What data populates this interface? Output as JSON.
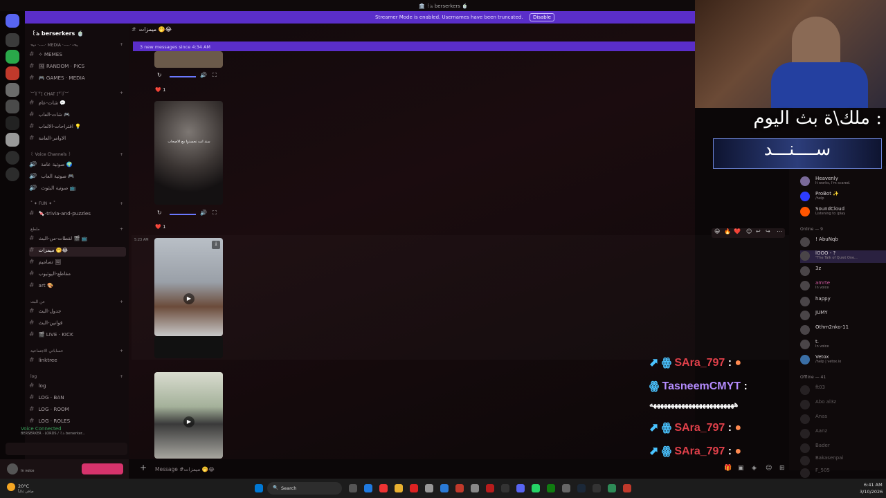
{
  "window": {
    "title": "🏛️ ꒰ঌ berserkers 🍵"
  },
  "banner": {
    "message": "Streamer Mode is enabled. Usernames have been truncated.",
    "disable": "Disable"
  },
  "server": {
    "name": "꒰ঌ berserkers 🍵"
  },
  "channel_header": {
    "name": "ميمزات 🤭😂"
  },
  "new_messages": "3 new messages since 4:34 AM",
  "channels": [
    {
      "label": "✧ MEMES",
      "type": "channel",
      "y": 0
    },
    {
      "label": "🖼 RANDOM · PICS",
      "type": "channel"
    },
    {
      "label": "🎮 GAMES · MEDIA",
      "type": "channel"
    }
  ],
  "categories": {
    "media": "ᯓ˖ ·----· MEDIA ·----· ˖ᯓ",
    "chat": "︶꒦꒷[ CHAT ]꒷꒦︶",
    "voice": "꒰ Voice Channels ꒱",
    "fun": "˚ ✦ FUN ✦ ˚",
    "bonus": "ملطع",
    "about": "عن البث",
    "social": "حساباتي الاجتماعية",
    "log": "log"
  },
  "chat_channels": [
    "شات-عام 💬",
    "شات-العاب 🎮",
    "اقتراحات-الالعاب 💡",
    "الاوامر-العامة"
  ],
  "voice_channels": [
    "صوتية عامة 🌍",
    "صوتية العاب 🎮",
    "صوتية البثوث 📺"
  ],
  "fun_channels": [
    "🍬-trivia-and-puzzles"
  ],
  "bonus_channels": [
    "لقطات-من-البث 🎬 📺",
    "ميمزات 🤭😂",
    "تصاميم 🖼",
    "مقاطع-اليوتيوب",
    "art 🎨"
  ],
  "about_channels": [
    "جدول-البث",
    "قوانين-البث",
    "🎬 LIVE · KICK"
  ],
  "social_channels": [
    "linktree"
  ],
  "log_channels": [
    "log",
    "LOG · BAN",
    "LOG · ROOM",
    "LOG · ROLES"
  ],
  "voice_connected": {
    "title": "Voice Connected",
    "sub": "BERSERKER · LORDS / ꒰ঌ berserker..."
  },
  "user": {
    "status": "In voice"
  },
  "messages": {
    "time": "5:23 AM",
    "reaction_count": "1",
    "video_caption": "سند انت تحسدوا مع الاصحاب"
  },
  "input": {
    "placeholder": "Message #ميمزات 🤭😂"
  },
  "members": {
    "bots": [
      {
        "name": "Heavenly",
        "badge": "APP",
        "status": "It works, I'm scared."
      },
      {
        "name": "ProBot ✨",
        "badge": "APP",
        "status": "/help"
      },
      {
        "name": "SoundCloud",
        "badge": "APP",
        "status": "Listening to /play"
      }
    ],
    "online_label": "Online — 9",
    "online": [
      {
        "name": "! AbuNqb",
        "status": ""
      },
      {
        "name": "lOOO - ?",
        "status": "\"The Talk of Quiet One..."
      },
      {
        "name": "3z",
        "status": ""
      },
      {
        "name": "amrte",
        "status": "In voice"
      },
      {
        "name": "happy",
        "status": ""
      },
      {
        "name": "JUMY",
        "status": ""
      },
      {
        "name": "Othm2nko-11",
        "status": ""
      },
      {
        "name": "t.",
        "status": "In voice"
      },
      {
        "name": "Vetox",
        "status": "/help | vetox.io"
      }
    ],
    "offline_label": "Offline — 41",
    "offline": [
      "ft03",
      "Abo al3z",
      "Anas",
      "Aanz",
      "Bader",
      "Bakasenpai",
      "F_505"
    ]
  },
  "overlay": {
    "title": "ملك\\ة بث اليوم :",
    "name": "ســــنـــد"
  },
  "stream_chat": [
    {
      "user": "SAra_797",
      "text": ":",
      "color": "#e0404a"
    },
    {
      "user": "TasneemCMYT",
      "text": ":",
      "color": "#b58cff"
    },
    {
      "user": "",
      "text": "ههههههههههههههههههههههههه",
      "color": "#ffffff"
    },
    {
      "user": "SAra_797",
      "text": ":",
      "color": "#e0404a"
    },
    {
      "user": "SAra_797",
      "text": ":",
      "color": "#e0404a"
    }
  ],
  "taskbar": {
    "weather": "20°C",
    "weather_sub": "صافي غالباً",
    "search": "Search",
    "time": "6:41 AM",
    "date": "3/10/2026"
  },
  "colors": {
    "accent": "#5a2ec9",
    "sidebar": "#120b0d",
    "main": "#1b0c0f"
  }
}
